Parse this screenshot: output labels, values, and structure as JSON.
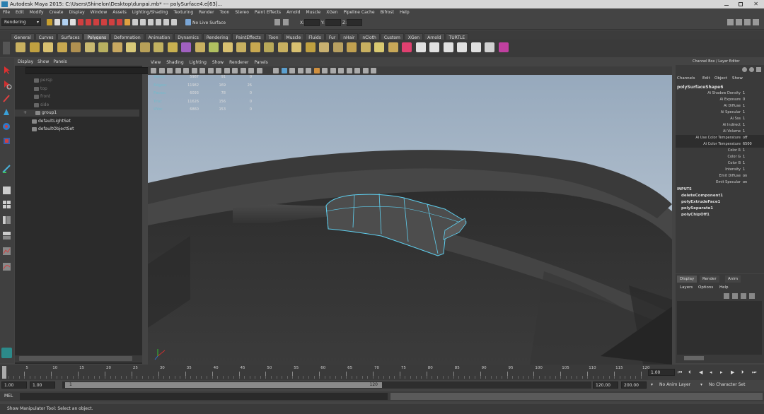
{
  "window": {
    "title": "Autodesk Maya 2015: C:\\Users\\Shinelon\\Desktop\\dunpai.mb*    ---    polySurface4.e[63]..."
  },
  "menubar": [
    "File",
    "Edit",
    "Modify",
    "Create",
    "Display",
    "Window",
    "Assets",
    "Lighting/Shading",
    "Texturing",
    "Render",
    "Toon",
    "Stereo",
    "Paint Effects",
    "Arnold",
    "Muscle",
    "XGen",
    "Pipeline Cache",
    "Bifrost",
    "Help"
  ],
  "status": {
    "mode": "Rendering",
    "live_surface": "No Live Surface",
    "x_label": "X:",
    "y_label": "Y:",
    "z_label": "Z:"
  },
  "shelf_tabs": [
    "General",
    "Curves",
    "Surfaces",
    "Polygons",
    "Deformation",
    "Animation",
    "Dynamics",
    "Rendering",
    "PaintEffects",
    "Toon",
    "Muscle",
    "Fluids",
    "Fur",
    "nHair",
    "nCloth",
    "Custom",
    "XGen",
    "Arnold",
    "TURTLE"
  ],
  "shelf_active": "Polygons",
  "outliner": {
    "menu": [
      "Display",
      "Show",
      "Panels"
    ],
    "items": [
      {
        "label": "persp",
        "dim": true
      },
      {
        "label": "top",
        "dim": true
      },
      {
        "label": "front",
        "dim": true
      },
      {
        "label": "side",
        "dim": true
      },
      {
        "label": "group1",
        "dim": false,
        "selected": true
      },
      {
        "label": "defaultLightSet",
        "dim": false
      },
      {
        "label": "defaultObjectSet",
        "dim": false
      }
    ]
  },
  "viewport": {
    "menu": [
      "View",
      "Shading",
      "Lighting",
      "Show",
      "Renderer",
      "Panels"
    ],
    "hud": [
      {
        "label": "Verts:",
        "a": "5987",
        "b": "91",
        "c": "0"
      },
      {
        "label": "Edges:",
        "a": "11982",
        "b": "169",
        "c": "26"
      },
      {
        "label": "Faces:",
        "a": "6093",
        "b": "78",
        "c": "0"
      },
      {
        "label": "Tris:",
        "a": "11626",
        "b": "156",
        "c": "0"
      },
      {
        "label": "UVs:",
        "a": "6860",
        "b": "153",
        "c": "0"
      }
    ]
  },
  "channelbox": {
    "title": "Channel Box / Layer Editor",
    "menu": [
      "Channels",
      "Edit",
      "Object",
      "Show"
    ],
    "object": "polySurfaceShape6",
    "attrs": [
      {
        "k": "Ai Shadow Density",
        "v": "1"
      },
      {
        "k": "Ai Exposure",
        "v": "0"
      },
      {
        "k": "Ai Diffuse",
        "v": "1"
      },
      {
        "k": "Ai Specular",
        "v": "1"
      },
      {
        "k": "Ai Sss",
        "v": "1"
      },
      {
        "k": "Ai Indirect",
        "v": "1"
      },
      {
        "k": "Ai Volume",
        "v": "1"
      },
      {
        "k": "Ai Use Color Temperature",
        "v": "off"
      },
      {
        "k": "Ai Color Temperature",
        "v": "6500"
      },
      {
        "k": "Color R",
        "v": "1"
      },
      {
        "k": "Color G",
        "v": "1"
      },
      {
        "k": "Color B",
        "v": "1"
      },
      {
        "k": "Intensity",
        "v": "1"
      },
      {
        "k": "Emit Diffuse",
        "v": "on"
      },
      {
        "k": "Emit Specular",
        "v": "on"
      }
    ],
    "inputs_label": "INPUTS",
    "inputs": [
      "deleteComponent1",
      "polyExtrudeFace1",
      "polySeparate1",
      "polyChipOff1"
    ]
  },
  "layer_editor": {
    "tabs": [
      "Display",
      "Render",
      "Anim"
    ],
    "menu": [
      "Layers",
      "Options",
      "Help"
    ]
  },
  "timeline": {
    "ticks": [
      "1",
      "5",
      "10",
      "15",
      "20",
      "25",
      "30",
      "35",
      "40",
      "45",
      "50",
      "55",
      "60",
      "65",
      "70",
      "75",
      "80",
      "85",
      "90",
      "95",
      "100",
      "105",
      "110",
      "115",
      "120"
    ],
    "current_frame": "1.00"
  },
  "range": {
    "start": "1.00",
    "start2": "1.00",
    "slider_start": "1",
    "slider_end": "120",
    "end": "120.00",
    "end2": "200.00",
    "anim_layer": "No Anim Layer",
    "character": "No Character Set"
  },
  "mel": {
    "label": "MEL"
  },
  "help": {
    "text": "Show Manipulator Tool: Select an object."
  }
}
